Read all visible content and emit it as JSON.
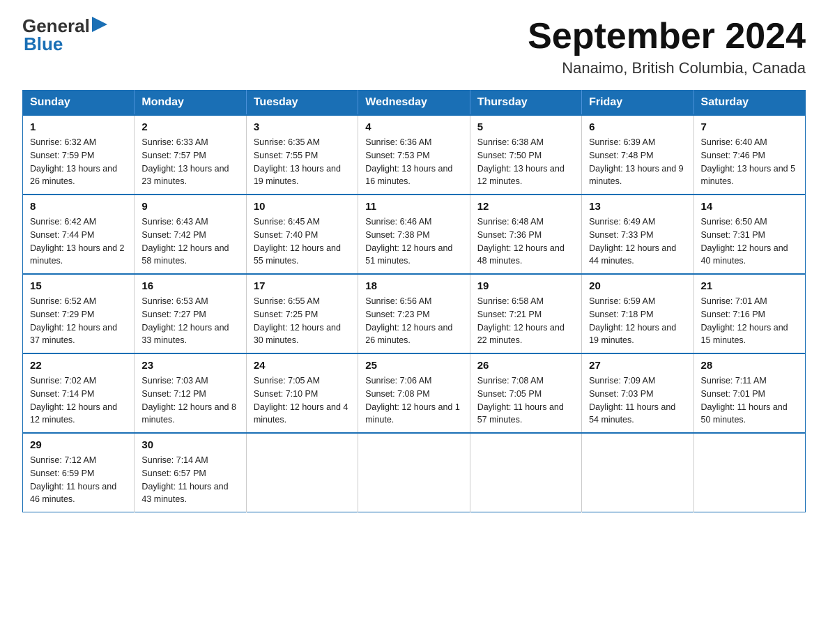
{
  "logo": {
    "general": "General",
    "blue": "Blue"
  },
  "title": "September 2024",
  "subtitle": "Nanaimo, British Columbia, Canada",
  "days_of_week": [
    "Sunday",
    "Monday",
    "Tuesday",
    "Wednesday",
    "Thursday",
    "Friday",
    "Saturday"
  ],
  "weeks": [
    [
      {
        "day": "1",
        "sunrise": "Sunrise: 6:32 AM",
        "sunset": "Sunset: 7:59 PM",
        "daylight": "Daylight: 13 hours and 26 minutes."
      },
      {
        "day": "2",
        "sunrise": "Sunrise: 6:33 AM",
        "sunset": "Sunset: 7:57 PM",
        "daylight": "Daylight: 13 hours and 23 minutes."
      },
      {
        "day": "3",
        "sunrise": "Sunrise: 6:35 AM",
        "sunset": "Sunset: 7:55 PM",
        "daylight": "Daylight: 13 hours and 19 minutes."
      },
      {
        "day": "4",
        "sunrise": "Sunrise: 6:36 AM",
        "sunset": "Sunset: 7:53 PM",
        "daylight": "Daylight: 13 hours and 16 minutes."
      },
      {
        "day": "5",
        "sunrise": "Sunrise: 6:38 AM",
        "sunset": "Sunset: 7:50 PM",
        "daylight": "Daylight: 13 hours and 12 minutes."
      },
      {
        "day": "6",
        "sunrise": "Sunrise: 6:39 AM",
        "sunset": "Sunset: 7:48 PM",
        "daylight": "Daylight: 13 hours and 9 minutes."
      },
      {
        "day": "7",
        "sunrise": "Sunrise: 6:40 AM",
        "sunset": "Sunset: 7:46 PM",
        "daylight": "Daylight: 13 hours and 5 minutes."
      }
    ],
    [
      {
        "day": "8",
        "sunrise": "Sunrise: 6:42 AM",
        "sunset": "Sunset: 7:44 PM",
        "daylight": "Daylight: 13 hours and 2 minutes."
      },
      {
        "day": "9",
        "sunrise": "Sunrise: 6:43 AM",
        "sunset": "Sunset: 7:42 PM",
        "daylight": "Daylight: 12 hours and 58 minutes."
      },
      {
        "day": "10",
        "sunrise": "Sunrise: 6:45 AM",
        "sunset": "Sunset: 7:40 PM",
        "daylight": "Daylight: 12 hours and 55 minutes."
      },
      {
        "day": "11",
        "sunrise": "Sunrise: 6:46 AM",
        "sunset": "Sunset: 7:38 PM",
        "daylight": "Daylight: 12 hours and 51 minutes."
      },
      {
        "day": "12",
        "sunrise": "Sunrise: 6:48 AM",
        "sunset": "Sunset: 7:36 PM",
        "daylight": "Daylight: 12 hours and 48 minutes."
      },
      {
        "day": "13",
        "sunrise": "Sunrise: 6:49 AM",
        "sunset": "Sunset: 7:33 PM",
        "daylight": "Daylight: 12 hours and 44 minutes."
      },
      {
        "day": "14",
        "sunrise": "Sunrise: 6:50 AM",
        "sunset": "Sunset: 7:31 PM",
        "daylight": "Daylight: 12 hours and 40 minutes."
      }
    ],
    [
      {
        "day": "15",
        "sunrise": "Sunrise: 6:52 AM",
        "sunset": "Sunset: 7:29 PM",
        "daylight": "Daylight: 12 hours and 37 minutes."
      },
      {
        "day": "16",
        "sunrise": "Sunrise: 6:53 AM",
        "sunset": "Sunset: 7:27 PM",
        "daylight": "Daylight: 12 hours and 33 minutes."
      },
      {
        "day": "17",
        "sunrise": "Sunrise: 6:55 AM",
        "sunset": "Sunset: 7:25 PM",
        "daylight": "Daylight: 12 hours and 30 minutes."
      },
      {
        "day": "18",
        "sunrise": "Sunrise: 6:56 AM",
        "sunset": "Sunset: 7:23 PM",
        "daylight": "Daylight: 12 hours and 26 minutes."
      },
      {
        "day": "19",
        "sunrise": "Sunrise: 6:58 AM",
        "sunset": "Sunset: 7:21 PM",
        "daylight": "Daylight: 12 hours and 22 minutes."
      },
      {
        "day": "20",
        "sunrise": "Sunrise: 6:59 AM",
        "sunset": "Sunset: 7:18 PM",
        "daylight": "Daylight: 12 hours and 19 minutes."
      },
      {
        "day": "21",
        "sunrise": "Sunrise: 7:01 AM",
        "sunset": "Sunset: 7:16 PM",
        "daylight": "Daylight: 12 hours and 15 minutes."
      }
    ],
    [
      {
        "day": "22",
        "sunrise": "Sunrise: 7:02 AM",
        "sunset": "Sunset: 7:14 PM",
        "daylight": "Daylight: 12 hours and 12 minutes."
      },
      {
        "day": "23",
        "sunrise": "Sunrise: 7:03 AM",
        "sunset": "Sunset: 7:12 PM",
        "daylight": "Daylight: 12 hours and 8 minutes."
      },
      {
        "day": "24",
        "sunrise": "Sunrise: 7:05 AM",
        "sunset": "Sunset: 7:10 PM",
        "daylight": "Daylight: 12 hours and 4 minutes."
      },
      {
        "day": "25",
        "sunrise": "Sunrise: 7:06 AM",
        "sunset": "Sunset: 7:08 PM",
        "daylight": "Daylight: 12 hours and 1 minute."
      },
      {
        "day": "26",
        "sunrise": "Sunrise: 7:08 AM",
        "sunset": "Sunset: 7:05 PM",
        "daylight": "Daylight: 11 hours and 57 minutes."
      },
      {
        "day": "27",
        "sunrise": "Sunrise: 7:09 AM",
        "sunset": "Sunset: 7:03 PM",
        "daylight": "Daylight: 11 hours and 54 minutes."
      },
      {
        "day": "28",
        "sunrise": "Sunrise: 7:11 AM",
        "sunset": "Sunset: 7:01 PM",
        "daylight": "Daylight: 11 hours and 50 minutes."
      }
    ],
    [
      {
        "day": "29",
        "sunrise": "Sunrise: 7:12 AM",
        "sunset": "Sunset: 6:59 PM",
        "daylight": "Daylight: 11 hours and 46 minutes."
      },
      {
        "day": "30",
        "sunrise": "Sunrise: 7:14 AM",
        "sunset": "Sunset: 6:57 PM",
        "daylight": "Daylight: 11 hours and 43 minutes."
      },
      null,
      null,
      null,
      null,
      null
    ]
  ]
}
